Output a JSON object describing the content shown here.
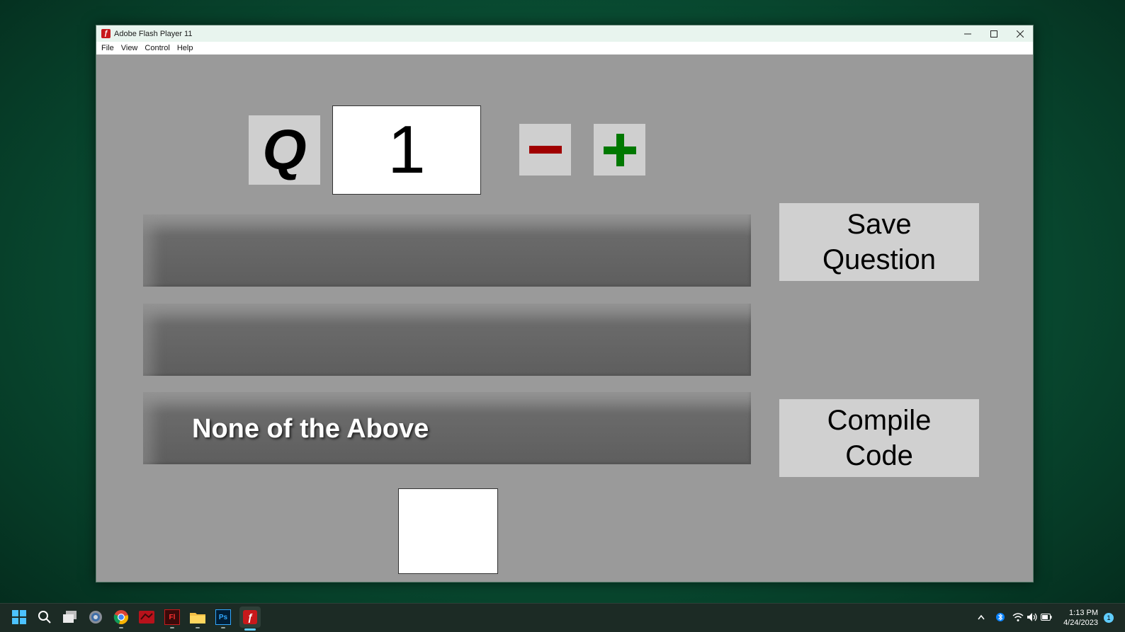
{
  "window": {
    "title": "Adobe Flash Player 11",
    "menu": [
      "File",
      "View",
      "Control",
      "Help"
    ]
  },
  "editor": {
    "question_label": "Q",
    "question_number": "1",
    "answers": [
      "",
      "",
      "None of the Above"
    ],
    "save_button": [
      "Save",
      "Question"
    ],
    "compile_button": [
      "Compile",
      "Code"
    ],
    "colors": {
      "minus": "#a00000",
      "plus": "#007800",
      "stage": "#9a9a9a",
      "answer_bar": "#5e5e5e"
    }
  },
  "taskbar": {
    "apps": [
      "start-icon",
      "search-icon",
      "task-view-icon",
      "settings-icon",
      "chrome-icon",
      "app-red-icon",
      "flash-pro-icon",
      "file-explorer-icon",
      "photoshop-icon",
      "flash-player-icon"
    ],
    "flash_pro_label": "Fl",
    "photoshop_label": "Ps",
    "time": "1:13 PM",
    "date": "4/24/2023",
    "notification_count": "1"
  }
}
